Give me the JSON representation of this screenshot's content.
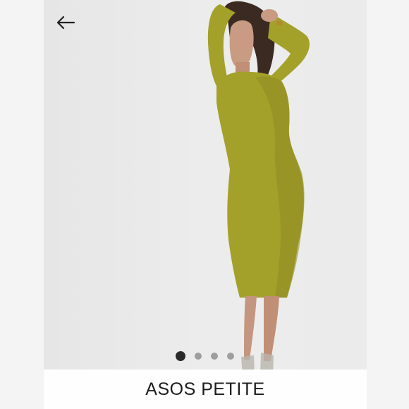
{
  "product": {
    "brand": "ASOS PETITE",
    "image_description_icon": "model-in-mustard-midi-dress"
  },
  "carousel": {
    "total": 4,
    "active_index": 0
  },
  "colors": {
    "dress": "#a3a12a",
    "background": "#eeeeee",
    "brand_bar": "#ffffff",
    "dot_active": "#2a2a2a",
    "dot_inactive": "#9e9e9e"
  }
}
